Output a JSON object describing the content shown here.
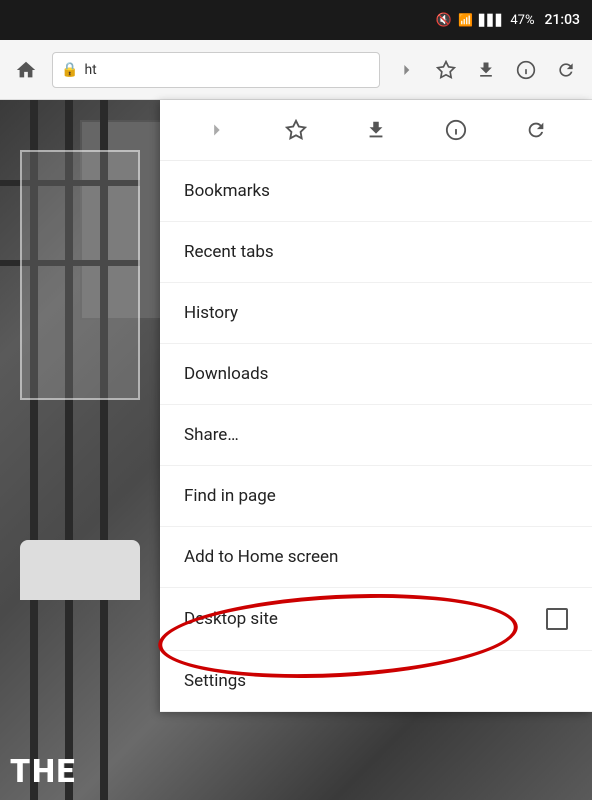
{
  "statusBar": {
    "mute_icon": "🔇",
    "wifi_icon": "📶",
    "signal_icon": "📶",
    "battery": "47%",
    "time": "21:03"
  },
  "addressBar": {
    "lock_icon": "🔒",
    "url": "ht"
  },
  "toolbarButtons": {
    "forward": "→",
    "bookmark": "☆",
    "download": "⬇",
    "info": "ⓘ",
    "reload": "↺"
  },
  "menuItems": [
    {
      "id": "bookmarks",
      "label": "Bookmarks",
      "has_checkbox": false
    },
    {
      "id": "recent-tabs",
      "label": "Recent tabs",
      "has_checkbox": false
    },
    {
      "id": "history",
      "label": "History",
      "has_checkbox": false
    },
    {
      "id": "downloads",
      "label": "Downloads",
      "has_checkbox": false
    },
    {
      "id": "share",
      "label": "Share…",
      "has_checkbox": false
    },
    {
      "id": "find-in-page",
      "label": "Find in page",
      "has_checkbox": false
    },
    {
      "id": "add-to-home",
      "label": "Add to Home screen",
      "has_checkbox": false
    },
    {
      "id": "desktop-site",
      "label": "Desktop site",
      "has_checkbox": true
    },
    {
      "id": "settings",
      "label": "Settings",
      "has_checkbox": false
    }
  ],
  "pageContent": {
    "the_label": "THE"
  }
}
